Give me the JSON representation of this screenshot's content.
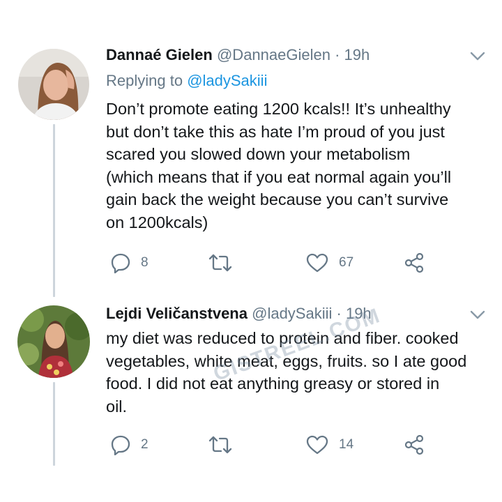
{
  "tweets": [
    {
      "name": "Dannaé Gielen",
      "handle": "@DannaeGielen",
      "separator": "·",
      "time": "19h",
      "replying_prefix": "Replying to ",
      "replying_to": "@ladySakiii",
      "text_lines": [
        "Don’t promote eating 1200 kcals!! It’s unhealthy",
        "but don’t take this as hate I’m proud of you just",
        "scared you slowed down your metabolism",
        "(which means that if you eat normal again you’ll",
        "gain back the weight because you can’t survive",
        "on 1200kcals)"
      ],
      "replies": "8",
      "retweets": "",
      "likes": "67"
    },
    {
      "name": "Lejdi Veličanstvena",
      "handle": "@ladySakiii",
      "separator": "·",
      "time": "19h",
      "text_lines": [
        "my diet was reduced to protein and fiber. cooked",
        "vegetables, white meat, eggs, fruits. so I ate good",
        "food. I did not eat anything greasy or stored in",
        "oil."
      ],
      "replies": "2",
      "retweets": "",
      "likes": "14"
    }
  ],
  "watermark": "GISTREEL.COM",
  "icons": {
    "reply": "reply-icon",
    "retweet": "retweet-icon",
    "like": "heart-icon",
    "share": "share-icon",
    "menu": "chevron-down-icon"
  },
  "colors": {
    "text": "#14171a",
    "secondary": "#657786",
    "link": "#1b95e0",
    "thread_line": "#cdd5dc"
  }
}
